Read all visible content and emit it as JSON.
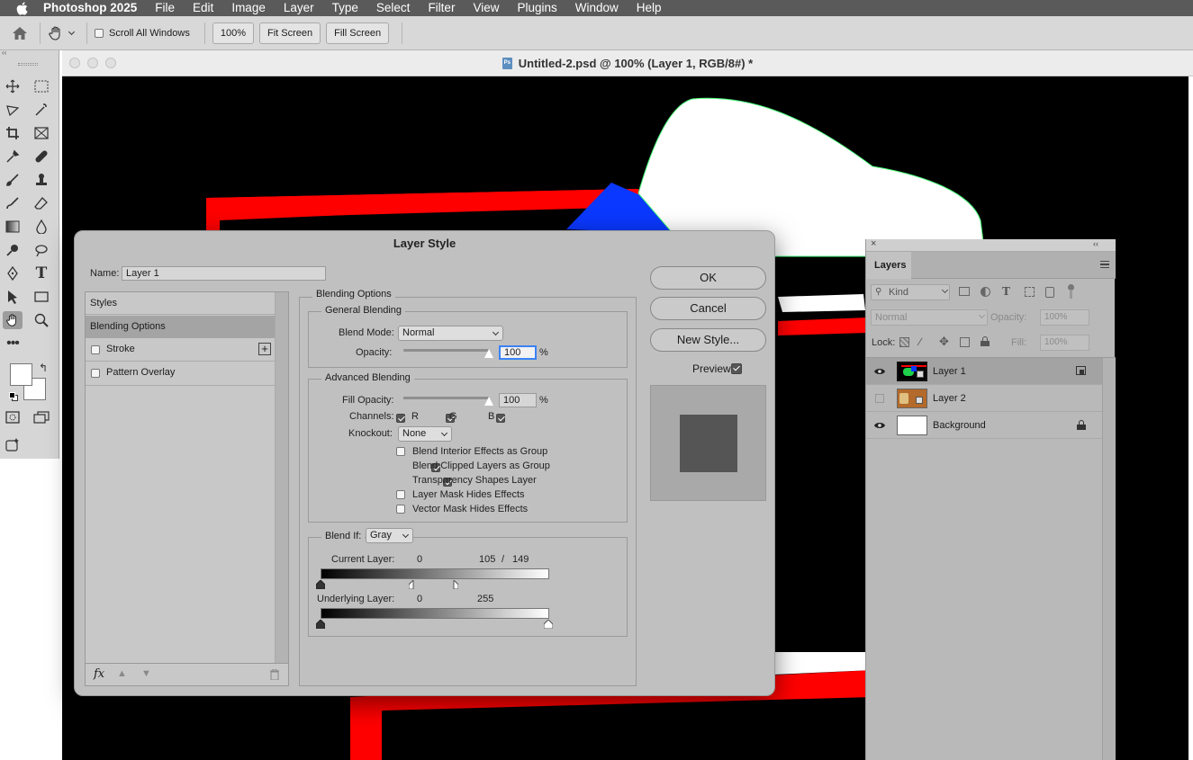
{
  "menubar": {
    "app": "Photoshop 2025",
    "items": [
      "File",
      "Edit",
      "Image",
      "Layer",
      "Type",
      "Select",
      "Filter",
      "View",
      "Plugins",
      "Window",
      "Help"
    ]
  },
  "optionsbar": {
    "scroll_all_windows": "Scroll All Windows",
    "zoom_btn": "100%",
    "fit_screen": "Fit Screen",
    "fill_screen": "Fill Screen"
  },
  "document": {
    "title": "Untitled-2.psd @ 100% (Layer 1, RGB/8#) *"
  },
  "dialog": {
    "title": "Layer Style",
    "name_label": "Name:",
    "name_value": "Layer 1",
    "styles_list": {
      "header": "Styles",
      "blending_options": "Blending Options",
      "stroke": "Stroke",
      "pattern_overlay": "Pattern Overlay"
    },
    "blending_options_title": "Blending Options",
    "general_blending": {
      "title": "General Blending",
      "blend_mode_label": "Blend Mode:",
      "blend_mode_value": "Normal",
      "opacity_label": "Opacity:",
      "opacity_value": "100",
      "pct": "%"
    },
    "advanced_blending": {
      "title": "Advanced Blending",
      "fill_opacity_label": "Fill Opacity:",
      "fill_opacity_value": "100",
      "pct": "%",
      "channels_label": "Channels:",
      "channel_r": "R",
      "channel_g": "G",
      "channel_b": "B",
      "knockout_label": "Knockout:",
      "knockout_value": "None",
      "opt1": "Blend Interior Effects as Group",
      "opt2": "Blend Clipped Layers as Group",
      "opt3": "Transparency Shapes Layer",
      "opt4": "Layer Mask Hides Effects",
      "opt5": "Vector Mask Hides Effects",
      "checked": [
        false,
        true,
        true,
        false,
        false
      ]
    },
    "blend_if": {
      "label": "Blend If:",
      "value": "Gray",
      "current_layer_label": "Current Layer:",
      "current_min": "0",
      "current_mid": "105",
      "current_slash": "/",
      "current_max": "149",
      "underlying_label": "Underlying Layer:",
      "underlying_min": "0",
      "underlying_max": "255"
    },
    "buttons": {
      "ok": "OK",
      "cancel": "Cancel",
      "new_style": "New Style...",
      "preview": "Preview"
    },
    "fx_label": "fx"
  },
  "layers_panel": {
    "tab": "Layers",
    "kind": "Kind",
    "blend": "Normal",
    "opacity_label": "Opacity:",
    "opacity_value": "100%",
    "lock_label": "Lock:",
    "fill_label": "Fill:",
    "fill_value": "100%",
    "layers": [
      {
        "name": "Layer 1",
        "visible": true
      },
      {
        "name": "Layer 2",
        "visible": false
      },
      {
        "name": "Background",
        "visible": true
      }
    ]
  },
  "colors": {
    "accent": "#3b82f6",
    "canvas_red": "#ff0000",
    "canvas_blue": "#0a38ff"
  }
}
